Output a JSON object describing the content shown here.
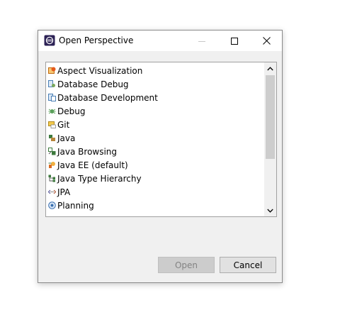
{
  "dialog": {
    "title": "Open Perspective",
    "app_icon": "eclipse-icon",
    "window_controls": [
      "minimize-icon",
      "maximize-icon",
      "close-icon"
    ]
  },
  "perspectives": [
    {
      "label": "Aspect Visualization",
      "icon": "aspect-visualization-icon",
      "color": "#e07a1f"
    },
    {
      "label": "Database Debug",
      "icon": "database-debug-icon",
      "color": "#4a7fb5"
    },
    {
      "label": "Database Development",
      "icon": "database-development-icon",
      "color": "#4a7fb5"
    },
    {
      "label": "Debug",
      "icon": "debug-bug-icon",
      "color": "#4c9a4c"
    },
    {
      "label": "Git",
      "icon": "git-icon",
      "color": "#d9a531"
    },
    {
      "label": "Java",
      "icon": "java-icon",
      "color": "#3d7a3d"
    },
    {
      "label": "Java Browsing",
      "icon": "java-browsing-icon",
      "color": "#3d7a3d"
    },
    {
      "label": "Java EE (default)",
      "icon": "java-ee-icon",
      "color": "#e0a030"
    },
    {
      "label": "Java Type Hierarchy",
      "icon": "type-hierarchy-icon",
      "color": "#3d7a3d"
    },
    {
      "label": "JPA",
      "icon": "jpa-icon",
      "color": "#5a5a9a"
    },
    {
      "label": "Planning",
      "icon": "planning-icon",
      "color": "#3a6fb0"
    }
  ],
  "buttons": {
    "open_label": "Open",
    "cancel_label": "Cancel"
  }
}
